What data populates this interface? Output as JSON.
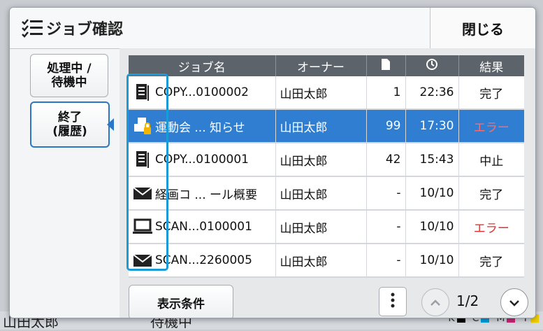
{
  "background": {
    "user": "山田太郎",
    "status": "待機中",
    "ink": [
      {
        "label": "K",
        "color": "#000000"
      },
      {
        "label": "C",
        "color": "#00a0e0"
      },
      {
        "label": "M",
        "color": "#d0257a"
      },
      {
        "label": "Y",
        "color": "#f0d000"
      }
    ]
  },
  "dialog": {
    "title": "ジョブ確認",
    "close_label": "閉じる"
  },
  "sidebar": {
    "processing_label": "処理中 /\n待機中",
    "completed_label": "終了\n(履歴)"
  },
  "table": {
    "headers": {
      "job_name": "ジョブ名",
      "owner": "オーナー",
      "pages_icon": "document-icon",
      "time_icon": "clock-icon",
      "result": "結果"
    },
    "rows": [
      {
        "icon": "copy-icon",
        "name": "COPY...0100002",
        "owner": "山田太郎",
        "pages": "1",
        "time": "22:36",
        "result": "完了",
        "result_color": "#111111",
        "selected": false
      },
      {
        "icon": "print-lock-icon",
        "name": "運動会 ... 知らせ",
        "owner": "山田太郎",
        "pages": "99",
        "time": "17:30",
        "result": "エラー",
        "result_color": "#e03131",
        "selected": true
      },
      {
        "icon": "copy-icon",
        "name": "COPY...0100001",
        "owner": "山田太郎",
        "pages": "42",
        "time": "15:43",
        "result": "中止",
        "result_color": "#111111",
        "selected": false
      },
      {
        "icon": "mail-icon",
        "name": "経画コ ... ール概要",
        "owner": "山田太郎",
        "pages": "-",
        "time": "10/10",
        "result": "完了",
        "result_color": "#111111",
        "selected": false
      },
      {
        "icon": "pc-icon",
        "name": "SCAN...0100001",
        "owner": "山田太郎",
        "pages": "-",
        "time": "10/10",
        "result": "エラー",
        "result_color": "#e03131",
        "selected": false
      },
      {
        "icon": "mail-icon",
        "name": "SCAN...2260005",
        "owner": "山田太郎",
        "pages": "-",
        "time": "10/10",
        "result": "完了",
        "result_color": "#111111",
        "selected": false
      }
    ]
  },
  "footer": {
    "display_conditions_label": "表示条件",
    "page_indicator": "1/2"
  },
  "colors": {
    "accent": "#2f7ed1",
    "highlight_frame": "#1a9ad6",
    "error": "#e03131"
  }
}
